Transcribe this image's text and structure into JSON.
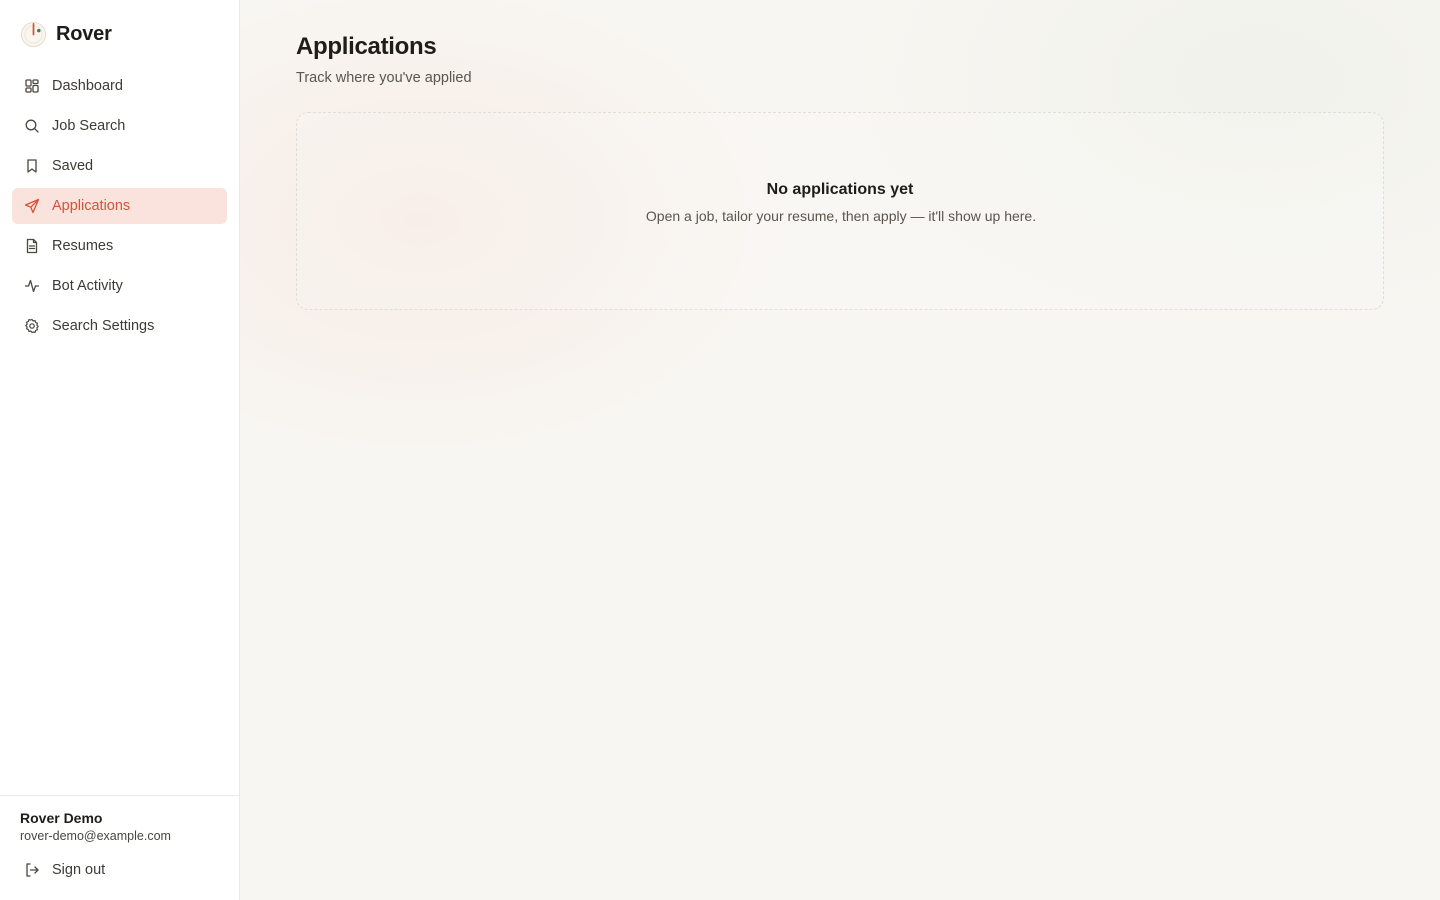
{
  "app": {
    "name": "Rover",
    "logo_icon": "rover-dial-logo-icon"
  },
  "colors": {
    "accent": "#d2543a",
    "active_bg": "#fbe3dd",
    "sidebar_bg": "#ffffff",
    "page_bg": "#f8f6f2"
  },
  "sidebar": {
    "items": [
      {
        "label": "Dashboard",
        "icon": "grid-icon",
        "active": false
      },
      {
        "label": "Job Search",
        "icon": "search-icon",
        "active": false
      },
      {
        "label": "Saved",
        "icon": "bookmark-icon",
        "active": false
      },
      {
        "label": "Applications",
        "icon": "send-icon",
        "active": true
      },
      {
        "label": "Resumes",
        "icon": "document-icon",
        "active": false
      },
      {
        "label": "Bot Activity",
        "icon": "activity-icon",
        "active": false
      },
      {
        "label": "Search Settings",
        "icon": "gear-icon",
        "active": false
      }
    ],
    "user": {
      "name": "Rover Demo",
      "email": "rover-demo@example.com"
    },
    "sign_out": {
      "label": "Sign out",
      "icon": "log-out-icon"
    }
  },
  "main": {
    "title": "Applications",
    "subtitle": "Track where you've applied",
    "empty_state": {
      "title": "No applications yet",
      "description": "Open a job, tailor your resume, then apply — it'll show up here."
    }
  }
}
